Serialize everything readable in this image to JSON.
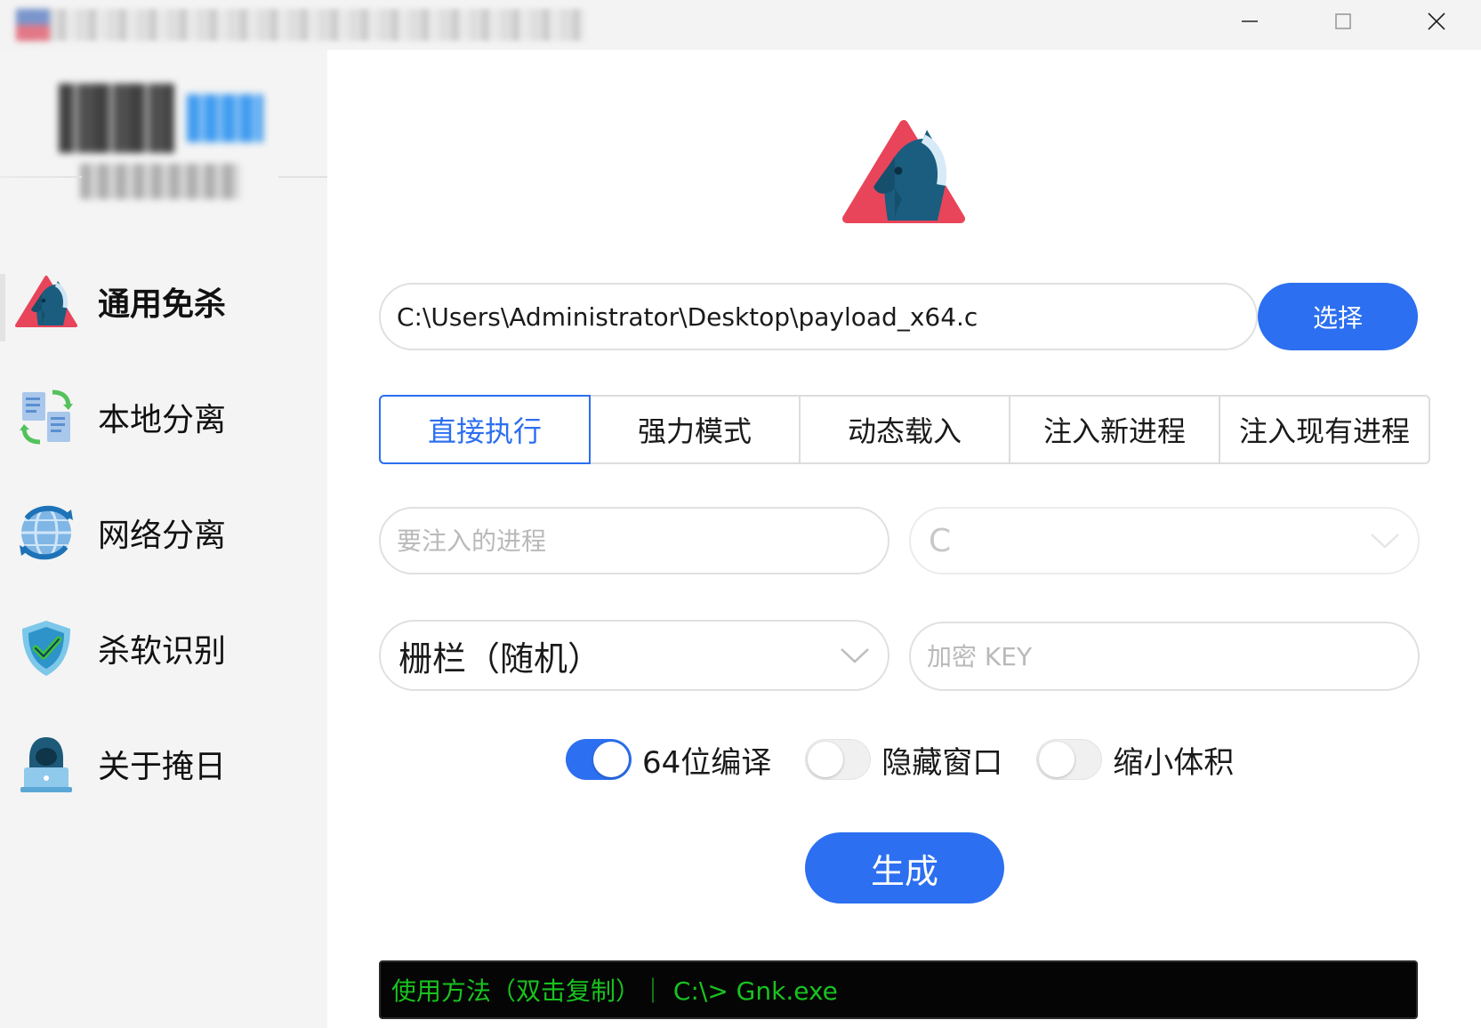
{
  "window": {
    "controls": {
      "minimize": "minimize-icon",
      "maximize": "maximize-icon",
      "close": "close-icon"
    }
  },
  "sidebar": {
    "items": [
      {
        "label": "通用免杀",
        "icon": "horse-icon",
        "active": true
      },
      {
        "label": "本地分离",
        "icon": "files-sync-icon",
        "active": false
      },
      {
        "label": "网络分离",
        "icon": "globe-sync-icon",
        "active": false
      },
      {
        "label": "杀软识别",
        "icon": "shield-check-icon",
        "active": false
      },
      {
        "label": "关于掩日",
        "icon": "hacker-laptop-icon",
        "active": false
      }
    ]
  },
  "main": {
    "path_input": {
      "value": "C:\\Users\\Administrator\\Desktop\\payload_x64.c"
    },
    "select_button": "选择",
    "tabs": [
      {
        "label": "直接执行",
        "active": true
      },
      {
        "label": "强力模式",
        "active": false
      },
      {
        "label": "动态载入",
        "active": false
      },
      {
        "label": "注入新进程",
        "active": false
      },
      {
        "label": "注入现有进程",
        "active": false
      }
    ],
    "process_input": {
      "placeholder": "要注入的进程",
      "value": ""
    },
    "language_select": {
      "value": "C"
    },
    "method_select": {
      "value": "栅栏（随机）"
    },
    "key_input": {
      "placeholder": "加密 KEY",
      "value": ""
    },
    "toggles": [
      {
        "label": "64位编译",
        "on": true
      },
      {
        "label": "隐藏窗口",
        "on": false
      },
      {
        "label": "缩小体积",
        "on": false
      }
    ],
    "generate_button": "生成",
    "console": "使用方法（双击复制）｜ C:\\> Gnk.exe"
  },
  "colors": {
    "accent": "#2c6ff0",
    "console_text": "#19c21f",
    "sidebar_bg": "#f4f4f4"
  }
}
